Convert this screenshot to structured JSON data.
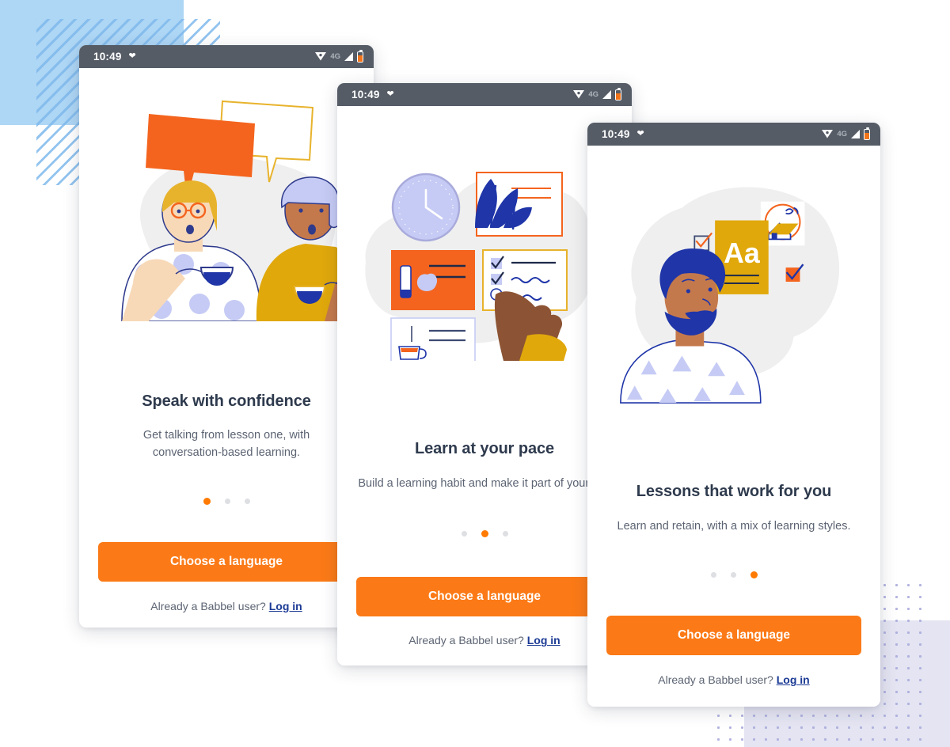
{
  "background": {
    "decorations": [
      {
        "name": "blue-solid-square",
        "color": "#AED6F5"
      },
      {
        "name": "blue-striped-square",
        "color": "#7FB9EC"
      },
      {
        "name": "lavender-solid-square",
        "color": "#E4E4F2"
      },
      {
        "name": "lavender-dotted-square",
        "color": "#A9ABDC"
      }
    ]
  },
  "colors": {
    "accent_orange": "#FB7A17",
    "dot_active": "#FF7A00",
    "dot_inactive": "#DDDFE3",
    "title": "#2E3A4D",
    "body_text": "#5C6473",
    "link_navy": "#1B3A94",
    "statusbar": "#555C66",
    "illustration_blob": "#EFEFEF",
    "yellow": "#E0A80B",
    "periwinkle": "#C6CBF5",
    "indigo": "#1F35A8"
  },
  "status_bar": {
    "time": "10:49",
    "heart_icon": "heart-icon",
    "wifi_icon": "wifi-icon",
    "network": "4G",
    "signal_icon": "signal-icon",
    "battery_icon": "battery-icon"
  },
  "shared": {
    "cta_label": "Choose a language",
    "login_prompt": "Already a Babbel user?",
    "login_link": "Log in"
  },
  "screens": [
    {
      "id": "speak-with-confidence",
      "title": "Speak with confidence",
      "subtitle": "Get talking from lesson one, with conversation-based learning.",
      "illustration": "two-women-talking-with-coffee-cups",
      "dots": {
        "count": 3,
        "active": 0
      }
    },
    {
      "id": "learn-at-your-pace",
      "title": "Learn at your pace",
      "subtitle": "Build a learning habit and make it part of your day",
      "illustration": "clock-plant-cards-and-pointing-hand",
      "dots": {
        "count": 3,
        "active": 1
      }
    },
    {
      "id": "lessons-that-work-for-you",
      "title": "Lessons that work for you",
      "subtitle": "Learn and retain, with a mix of learning styles.",
      "illustration": "man-with-alphabet-card-and-checkmarks",
      "dots": {
        "count": 3,
        "active": 2
      }
    }
  ]
}
